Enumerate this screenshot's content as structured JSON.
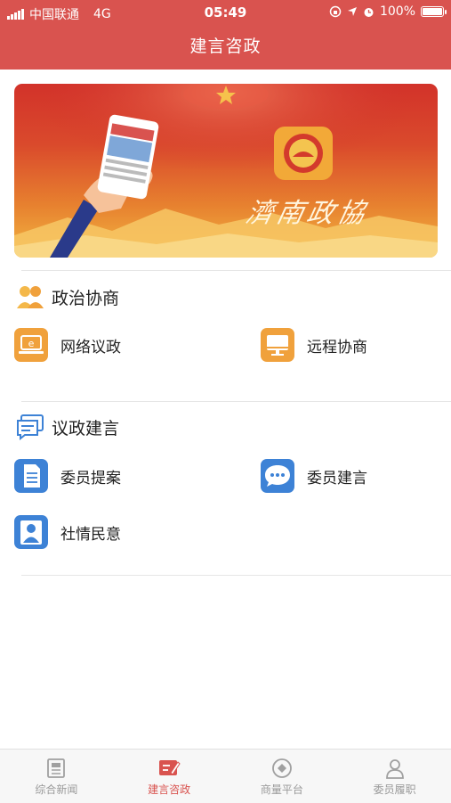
{
  "status_bar": {
    "carrier": "中国联通",
    "network": "4G",
    "time": "05:49",
    "battery": "100%"
  },
  "header": {
    "title": "建言咨政"
  },
  "banner": {
    "calligraphy": "濟南政協"
  },
  "sections": [
    {
      "title": "政治协商",
      "items": [
        {
          "label": "网络议政",
          "icon": "laptop-icon"
        },
        {
          "label": "远程协商",
          "icon": "monitor-icon"
        }
      ]
    },
    {
      "title": "议政建言",
      "items": [
        {
          "label": "委员提案",
          "icon": "document-icon"
        },
        {
          "label": "委员建言",
          "icon": "chat-bubble-icon"
        },
        {
          "label": "社情民意",
          "icon": "person-icon"
        }
      ]
    }
  ],
  "tabs": [
    {
      "label": "综合新闻",
      "icon": "newspaper-icon",
      "active": false
    },
    {
      "label": "建言咨政",
      "icon": "compose-icon",
      "active": true
    },
    {
      "label": "商量平台",
      "icon": "discuss-icon",
      "active": false
    },
    {
      "label": "委员履职",
      "icon": "user-icon",
      "active": false
    }
  ],
  "colors": {
    "primary": "#d9534f",
    "orange_icon": "#f0a13c",
    "blue_icon": "#3d82d6",
    "tab_inactive": "#9a9a9a"
  }
}
